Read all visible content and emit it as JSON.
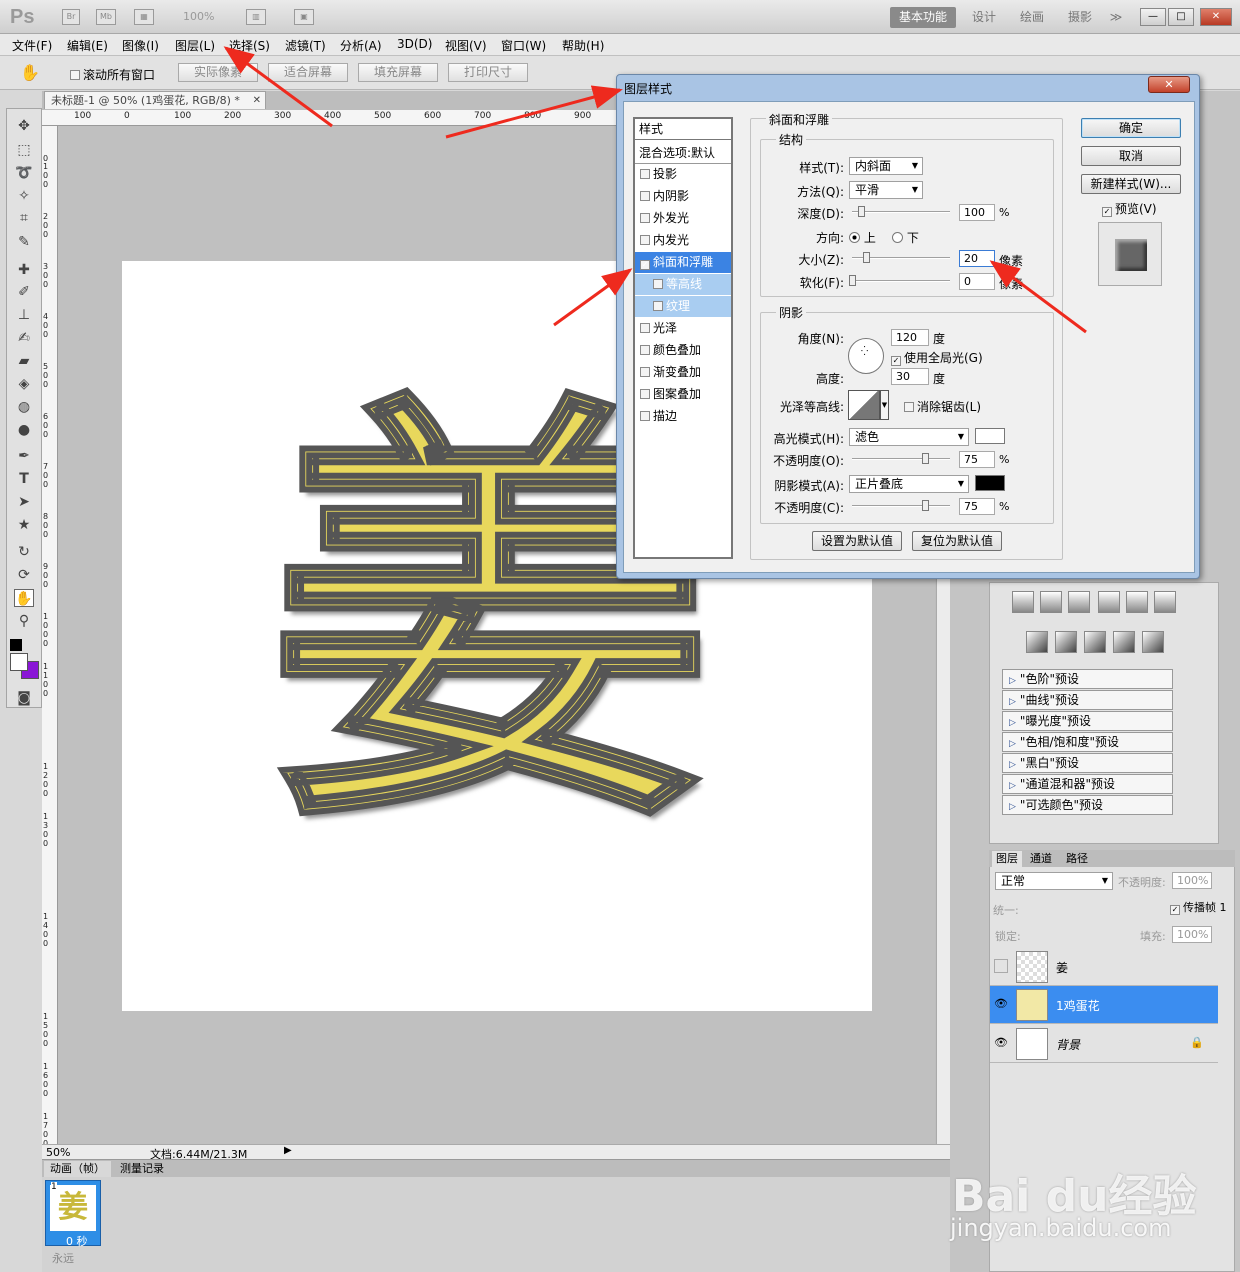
{
  "app": {
    "logo": "Ps",
    "zoom": "100%",
    "workspace_active": "基本功能",
    "workspaces": [
      "设计",
      "绘画",
      "摄影"
    ],
    "more": "≫"
  },
  "window_buttons": {
    "min": "—",
    "max": "□",
    "close": "✕"
  },
  "menu": [
    "文件(F)",
    "编辑(E)",
    "图像(I)",
    "图层(L)",
    "选择(S)",
    "滤镜(T)",
    "分析(A)",
    "3D(D)",
    "视图(V)",
    "窗口(W)",
    "帮助(H)"
  ],
  "options": {
    "scroll_all": "滚动所有窗口",
    "actual_pixels": "实际像素",
    "fit_screen": "适合屏幕",
    "fill_screen": "填充屏幕",
    "print_size": "打印尺寸"
  },
  "document": {
    "tab": "未标题-1 @ 50% (1鸡蛋花, RGB/8) *",
    "tab_close": "✕",
    "hruler": [
      "100",
      "0",
      "100",
      "200",
      "300",
      "400",
      "500",
      "600",
      "700",
      "800",
      "900"
    ],
    "vruler": [
      "0",
      "100",
      "200",
      "300",
      "400",
      "500",
      "600",
      "700",
      "800",
      "900",
      "1000",
      "1100",
      "1200",
      "1300",
      "1400",
      "1500",
      "1600",
      "1700"
    ],
    "glyph": "姜"
  },
  "status": {
    "zoom": "50%",
    "doc": "文档:6.44M/21.3M"
  },
  "animation": {
    "tabs": [
      "动画（帧）",
      "测量记录"
    ],
    "frame_num": "1",
    "frame_time": "0 秒",
    "loop": "永远"
  },
  "dialog": {
    "title": "图层样式",
    "close": "✕",
    "styles_header": "样式",
    "blend_default": "混合选项:默认",
    "styles": [
      {
        "label": "投影",
        "checked": false,
        "selected": false,
        "sub": false
      },
      {
        "label": "内阴影",
        "checked": false,
        "selected": false,
        "sub": false
      },
      {
        "label": "外发光",
        "checked": false,
        "selected": false,
        "sub": false
      },
      {
        "label": "内发光",
        "checked": false,
        "selected": false,
        "sub": false
      },
      {
        "label": "斜面和浮雕",
        "checked": true,
        "selected": true,
        "sub": false
      },
      {
        "label": "等高线",
        "checked": false,
        "selected": false,
        "sub": true
      },
      {
        "label": "纹理",
        "checked": false,
        "selected": false,
        "sub": true
      },
      {
        "label": "光泽",
        "checked": false,
        "selected": false,
        "sub": false
      },
      {
        "label": "颜色叠加",
        "checked": false,
        "selected": false,
        "sub": false
      },
      {
        "label": "渐变叠加",
        "checked": false,
        "selected": false,
        "sub": false
      },
      {
        "label": "图案叠加",
        "checked": false,
        "selected": false,
        "sub": false
      },
      {
        "label": "描边",
        "checked": false,
        "selected": false,
        "sub": false
      }
    ],
    "bevel": {
      "group": "斜面和浮雕",
      "structure": "结构",
      "style_label": "样式(T):",
      "style_value": "内斜面",
      "technique_label": "方法(Q):",
      "technique_value": "平滑",
      "depth_label": "深度(D):",
      "depth_value": "100",
      "depth_unit": "%",
      "direction_label": "方向:",
      "up": "上",
      "down": "下",
      "size_label": "大小(Z):",
      "size_value": "20",
      "size_unit": "像素",
      "soften_label": "软化(F):",
      "soften_value": "0",
      "soften_unit": "像素"
    },
    "shading": {
      "group": "阴影",
      "angle_label": "角度(N):",
      "angle_value": "120",
      "angle_unit": "度",
      "global_light": "使用全局光(G)",
      "altitude_label": "高度:",
      "altitude_value": "30",
      "altitude_unit": "度",
      "gloss_label": "光泽等高线:",
      "antialias": "消除锯齿(L)",
      "hl_mode_label": "高光模式(H):",
      "hl_mode_value": "滤色",
      "hl_color": "#ffffff",
      "hl_opacity_label": "不透明度(O):",
      "hl_opacity_value": "75",
      "hl_opacity_unit": "%",
      "sh_mode_label": "阴影模式(A):",
      "sh_mode_value": "正片叠底",
      "sh_color": "#000000",
      "sh_opacity_label": "不透明度(C):",
      "sh_opacity_value": "75",
      "sh_opacity_unit": "%"
    },
    "make_default": "设置为默认值",
    "reset_default": "复位为默认值",
    "ok": "确定",
    "cancel": "取消",
    "new_style": "新建样式(W)...",
    "preview": "预览(V)"
  },
  "adjust_presets": [
    "\"色阶\"预设",
    "\"曲线\"预设",
    "\"曝光度\"预设",
    "\"色相/饱和度\"预设",
    "\"黑白\"预设",
    "\"通道混和器\"预设",
    "\"可选颜色\"预设"
  ],
  "layers": {
    "tabs": [
      "图层",
      "通道",
      "路径"
    ],
    "blend": "正常",
    "opacity_label": "不透明度:",
    "opacity": "100%",
    "unify": "统一:",
    "propagate": "传播帧 1",
    "lock": "锁定:",
    "fill_label": "填充:",
    "fill": "100%",
    "items": [
      {
        "name": "姜",
        "visible": false,
        "selected": false
      },
      {
        "name": "1鸡蛋花",
        "visible": true,
        "selected": true
      },
      {
        "name": "背景",
        "visible": true,
        "selected": false
      }
    ]
  },
  "watermark": {
    "brand": "Bai du经验",
    "url": "jingyan.baidu.com"
  },
  "colors": {
    "accent": "#3b83e3",
    "arrow": "#ee2a1e"
  }
}
